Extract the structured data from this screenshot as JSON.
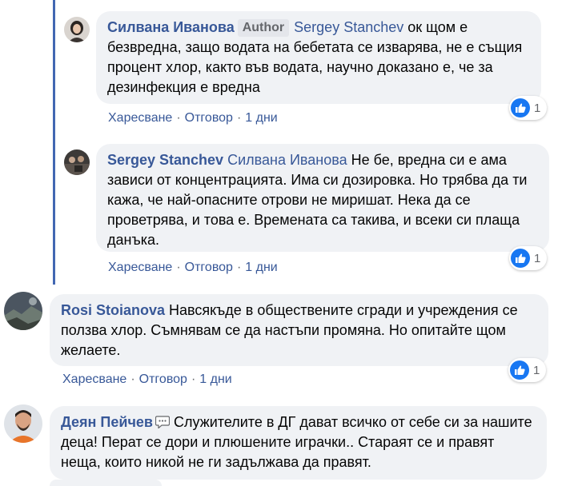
{
  "comments": [
    {
      "author": "Силвана Иванова",
      "badge": "Author",
      "mention": "Sergey Stanchev",
      "text": " ок щом е безвредна, защо водата на бебетата се изварява, не е същия процент хлор, както във водата, научно доказано е, че за дезинфекция е вредна",
      "like": "Харесване",
      "reply": "Отговор",
      "time": "1 дни",
      "reactions": "1"
    },
    {
      "author": "Sergey Stanchev",
      "mention": "Силвана Иванова",
      "text": " Не бе, вредна си е ама зависи от концентрацията. Има си дозировка. Но трябва да ти кажа, че най-опасните отрови не миришат. Нека да се проветрява, и това е. Времената са такива, и всеки си плаща данъка.",
      "like": "Харесване",
      "reply": "Отговор",
      "time": "1 дни",
      "reactions": "1"
    },
    {
      "author": "Rosi Stoianova",
      "text": " Навсякъде в обществените сгради и учреждения се ползва хлор. Съмнявам се да настъпи промяна. Но опитайте щом желаете.",
      "like": "Харесване",
      "reply": "Отговор",
      "time": "1 дни",
      "reactions": "1"
    },
    {
      "author": "Деян Пейчев",
      "text": " Служителите в ДГ дават всичко от себе си за нашите деца! Перат се дори и плюшените играчки.. Стараят се и правят неща, които никой не ги задължава да правят."
    }
  ],
  "separator": "·",
  "icons": {
    "like": "like-thumb-icon",
    "chat": "chat-bubble-icon"
  },
  "colors": {
    "name": "#385898",
    "like": "#1877f2",
    "bubble": "#f0f2f5",
    "thread_line": "#4267b2"
  }
}
